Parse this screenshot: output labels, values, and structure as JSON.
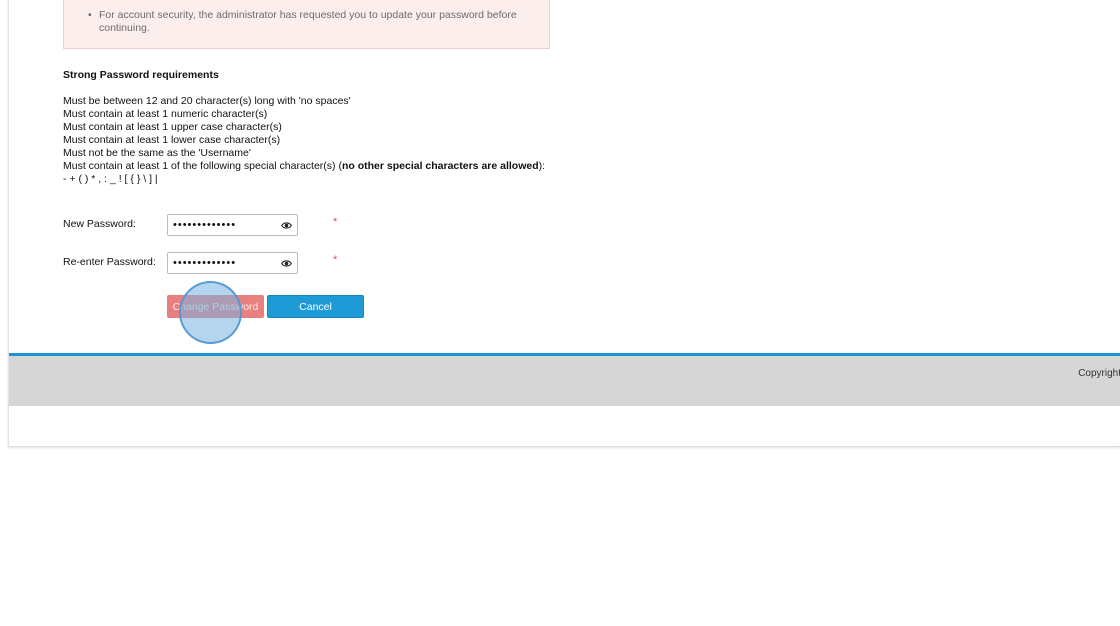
{
  "alert": {
    "message": "For account security, the administrator has requested you to update your password before continuing."
  },
  "requirements": {
    "title": "Strong Password requirements",
    "rules": [
      "Must be between 12 and 20 character(s) long with 'no spaces'",
      "Must contain at least 1 numeric character(s)",
      "Must contain at least 1 upper case character(s)",
      "Must contain at least 1 lower case character(s)",
      "Must not be the same as the 'Username'"
    ],
    "special_prefix": "Must contain at least 1 of the following special character(s) (",
    "special_bold": "no other special characters are allowed",
    "special_suffix": "):",
    "special_chars": "- + ( ) * , : _ ! [ { } \\ ] |"
  },
  "form": {
    "new_password_label": "New Password:",
    "new_password_value": "•••••••••••••",
    "reenter_password_label": "Re-enter Password:",
    "reenter_password_value": "•••••••••••••",
    "required_marker": "*"
  },
  "buttons": {
    "change_password": "Change Password",
    "cancel": "Cancel"
  },
  "footer": {
    "copyright": "Copyright"
  },
  "colors": {
    "accent": "#1e93cf",
    "change_button": "#e98080",
    "cancel_button": "#1e9ad6",
    "alert_bg": "#fdeeee",
    "required": "#d9534f"
  }
}
